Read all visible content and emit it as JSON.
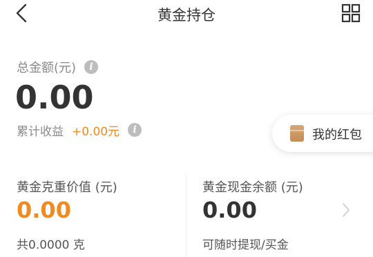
{
  "header": {
    "title": "黄金持仓",
    "back_icon": "chevron-left-icon",
    "menu_icon": "grid-icon"
  },
  "summary": {
    "total_label": "总金额(元)",
    "total_value": "0.00",
    "cumulative_label": "累计收益",
    "cumulative_value": "+0.00元"
  },
  "red_packet": {
    "label": "我的红包",
    "icon": "red-packet-icon"
  },
  "gold_weight": {
    "label": "黄金克重价值 (元)",
    "value": "0.00",
    "quantity": "共0.0000 克"
  },
  "cash_balance": {
    "label": "黄金现金余额 (元)",
    "value": "0.00",
    "subtitle": "可随时提现/买金"
  },
  "colors": {
    "accent": "#f08a22",
    "text": "#333333",
    "muted": "#8a8a8a"
  }
}
